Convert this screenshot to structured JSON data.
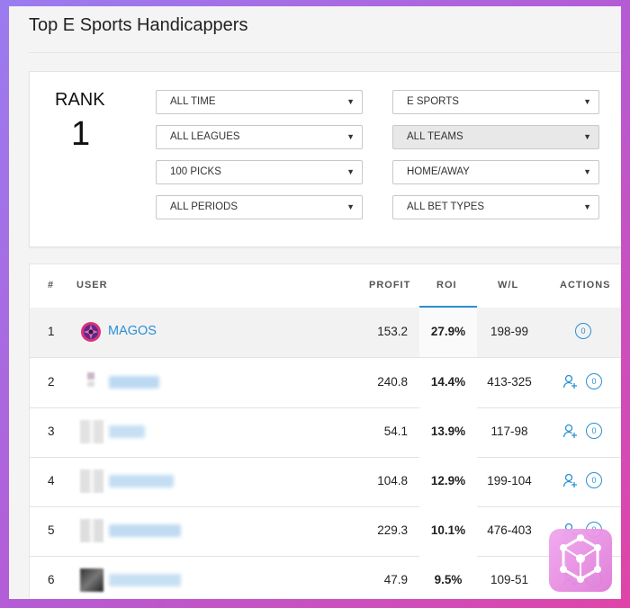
{
  "page": {
    "title": "Top E Sports Handicappers"
  },
  "rank": {
    "label": "RANK",
    "value": "1"
  },
  "filters": {
    "time": "ALL TIME",
    "sport": "E SPORTS",
    "league": "ALL LEAGUES",
    "team": "ALL TEAMS",
    "picks": "100 PICKS",
    "location": "HOME/AWAY",
    "period": "ALL PERIODS",
    "bet_type": "ALL BET TYPES"
  },
  "table": {
    "headers": {
      "rank": "#",
      "user": "USER",
      "profit": "PROFIT",
      "roi": "ROI",
      "wl": "W/L",
      "actions": "ACTIONS"
    },
    "rows": [
      {
        "rank": "1",
        "user": "MAGOS",
        "profit": "153.2",
        "roi": "27.9%",
        "wl": "198-99",
        "count": "0"
      },
      {
        "rank": "2",
        "user": "",
        "profit": "240.8",
        "roi": "14.4%",
        "wl": "413-325",
        "count": "0"
      },
      {
        "rank": "3",
        "user": "",
        "profit": "54.1",
        "roi": "13.9%",
        "wl": "117-98",
        "count": "0"
      },
      {
        "rank": "4",
        "user": "",
        "profit": "104.8",
        "roi": "12.9%",
        "wl": "199-104",
        "count": "0"
      },
      {
        "rank": "5",
        "user": "",
        "profit": "229.3",
        "roi": "10.1%",
        "wl": "476-403",
        "count": "0"
      },
      {
        "rank": "6",
        "user": "",
        "profit": "47.9",
        "roi": "9.5%",
        "wl": "109-51",
        "count": "0"
      }
    ]
  },
  "colors": {
    "accent": "#2a8fd4",
    "highlight_row": "#f2f2f2"
  },
  "icons": {
    "follow": "add-user-icon",
    "corner": "hexagon-network-logo-icon",
    "avatar": "magos-logo-icon"
  }
}
